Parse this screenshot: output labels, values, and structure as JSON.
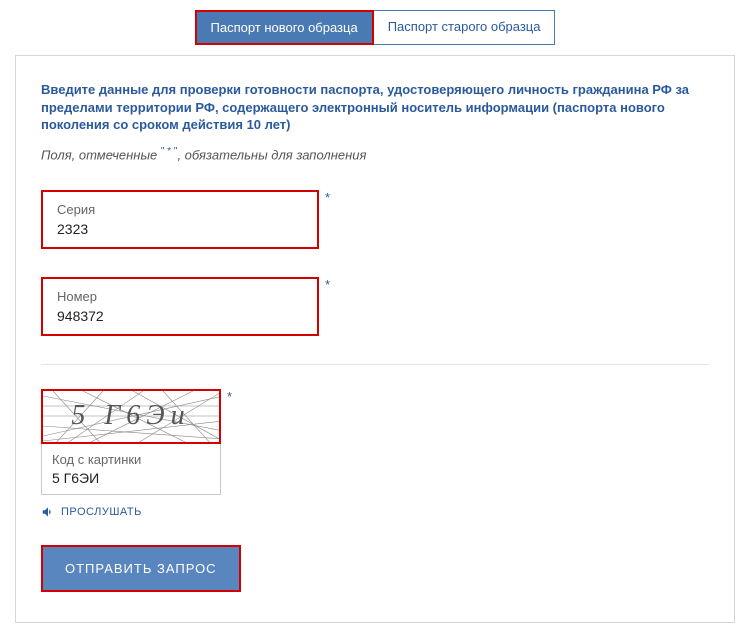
{
  "tabs": {
    "new": "Паспорт нового образца",
    "old": "Паспорт старого образца"
  },
  "intro": "Введите данные для проверки готовности паспорта, удостоверяющего личность гражданина РФ за пределами территории РФ, содержащего электронный носитель информации (паспорта нового поколения со сроком действия 10 лет)",
  "required_note_pre": "Поля, отмеченные ",
  "required_note_star": "\" * \"",
  "required_note_post": ", обязательны для заполнения",
  "fields": {
    "series": {
      "label": "Серия",
      "value": "2323"
    },
    "number": {
      "label": "Номер",
      "value": "948372"
    }
  },
  "captcha": {
    "image_text": "5 Г6Эи",
    "label": "Код с картинки",
    "value": "5 Г6ЭИ",
    "listen": "ПРОСЛУШАТЬ"
  },
  "submit": "ОТПРАВИТЬ ЗАПРОС",
  "star": "*"
}
